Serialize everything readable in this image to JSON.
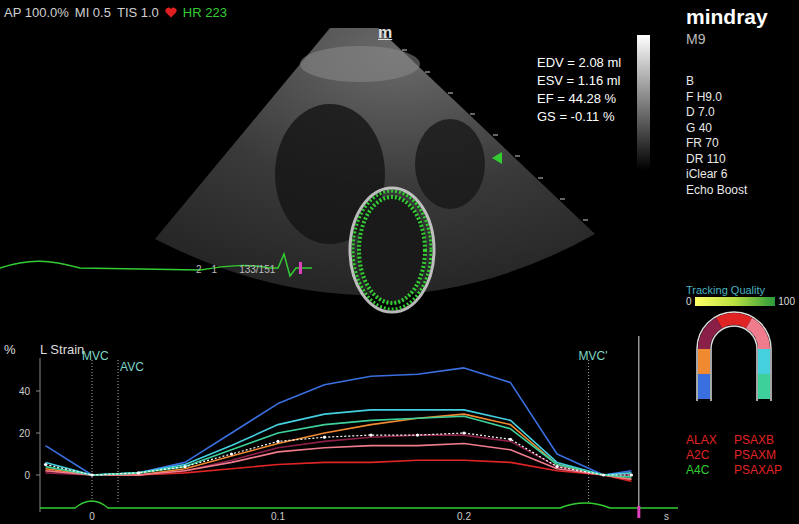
{
  "status_bar": {
    "items": [
      "AP 100.0%",
      "MI 0.5",
      "TIS 1.0"
    ],
    "heart_rate": "HR 223"
  },
  "brand": {
    "logo": "mindray",
    "model": "M9"
  },
  "image": {
    "marker": "m",
    "probe_marks": [
      "2",
      "1"
    ],
    "frame": "133/151"
  },
  "measurements": [
    "EDV = 2.08 ml",
    "ESV = 1.16 ml",
    "EF = 44.28 %",
    "GS = -0.11 %"
  ],
  "parameters": [
    "B",
    "F H9.0",
    "D 7.0",
    "G 40",
    "FR 70",
    "DR 110",
    "iClear 6",
    "Echo Boost"
  ],
  "tracking_quality": {
    "title": "Tracking Quality",
    "min": "0",
    "max": "100"
  },
  "chart": {
    "unit": "%",
    "title": "L Strain",
    "y_ticks": [
      {
        "label": "40",
        "value": 40
      },
      {
        "label": "20",
        "value": 20
      },
      {
        "label": "0",
        "value": 0
      }
    ],
    "x_ticks": [
      {
        "label": "0",
        "value": 0
      },
      {
        "label": "0.1",
        "value": 0.1
      },
      {
        "label": "0.2",
        "value": 0.2
      }
    ],
    "x_unit": "s",
    "events": [
      {
        "label": "MVC",
        "time": 0
      },
      {
        "label": "AVC",
        "time": 0.014
      },
      {
        "label": "MVC'",
        "time": 0.267
      }
    ],
    "cursor_time": 0.294,
    "times": [
      -0.025,
      0,
      0.025,
      0.05,
      0.075,
      0.1,
      0.125,
      0.15,
      0.175,
      0.2,
      0.225,
      0.25,
      0.275,
      0.29
    ],
    "series": [
      {
        "color": "#e02424",
        "values": [
          2,
          0,
          0,
          1,
          3,
          5,
          6,
          6,
          7,
          7,
          6,
          2,
          0,
          -3
        ]
      },
      {
        "color": "#8a1f48",
        "values": [
          1,
          0,
          0,
          2,
          7,
          13,
          16,
          18,
          19,
          19,
          16,
          4,
          0,
          0
        ]
      },
      {
        "color": "#f08a30",
        "values": [
          3,
          0,
          0,
          3,
          9,
          15,
          20,
          24,
          27,
          29,
          24,
          5,
          0,
          -2
        ]
      },
      {
        "color": "#3a6fe0",
        "values": [
          14,
          0,
          1,
          6,
          20,
          34,
          43,
          47,
          48,
          51,
          44,
          10,
          0,
          2
        ]
      },
      {
        "color": "#f07b8c",
        "values": [
          2,
          0,
          0,
          2,
          6,
          11,
          13,
          14,
          14,
          15,
          12,
          3,
          0,
          -2
        ]
      },
      {
        "color": "#45d0e0",
        "values": [
          6,
          0,
          1,
          5,
          14,
          24,
          29,
          31,
          31,
          31,
          26,
          6,
          0,
          1
        ]
      },
      {
        "color": "#3ed09a",
        "values": [
          4,
          0,
          1,
          4,
          12,
          20,
          24,
          26,
          27,
          28,
          22,
          5,
          0,
          -1
        ]
      }
    ],
    "average": {
      "color": "#ffffff",
      "values": [
        5,
        0,
        1,
        4,
        10,
        16,
        18,
        19,
        19,
        20,
        17,
        4,
        0,
        0
      ]
    }
  },
  "views": [
    {
      "label": "ALAX",
      "selected": false
    },
    {
      "label": "PSAXB",
      "selected": false
    },
    {
      "label": "A2C",
      "selected": false
    },
    {
      "label": "PSAXM",
      "selected": false
    },
    {
      "label": "A4C",
      "selected": true
    },
    {
      "label": "PSAXAP",
      "selected": false
    }
  ]
}
